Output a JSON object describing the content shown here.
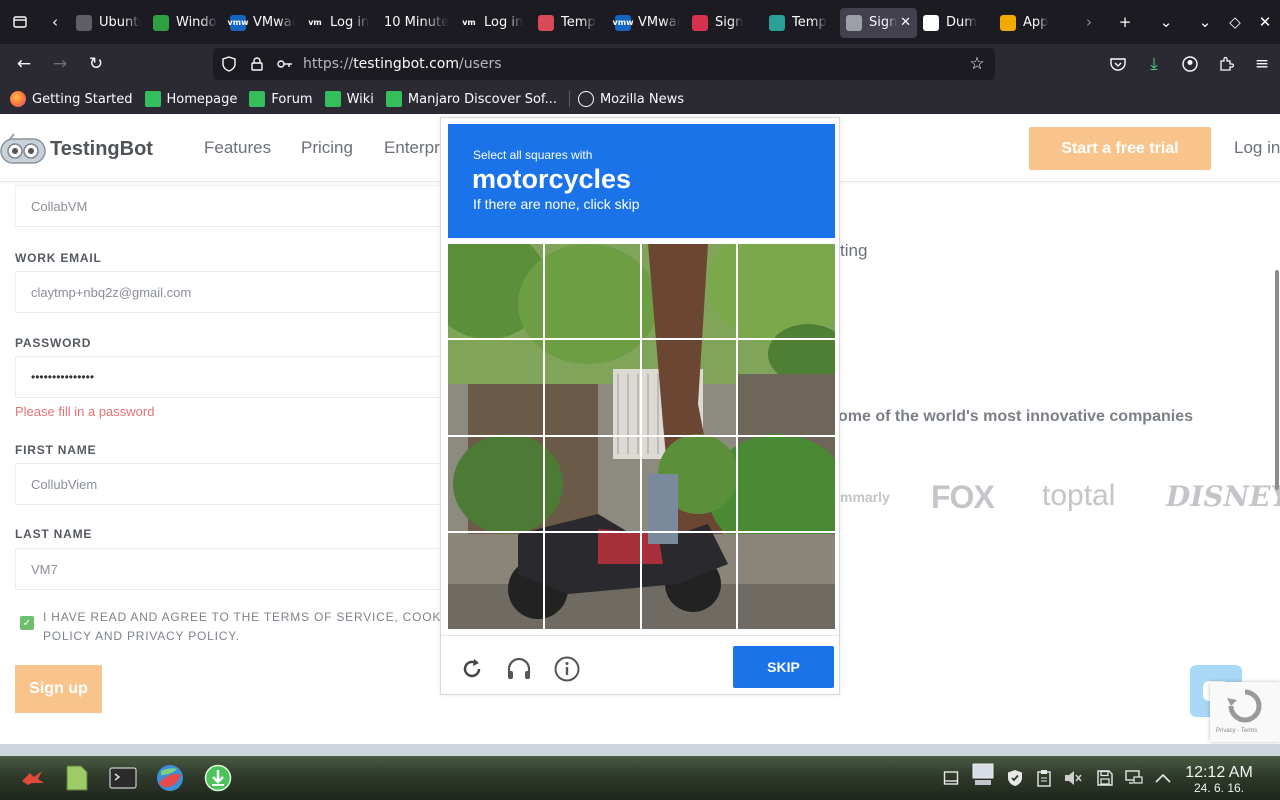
{
  "browser": {
    "tabs": [
      {
        "label": "Ubuntu",
        "fav_color": "#5e5e66",
        "fav_text": ""
      },
      {
        "label": "Windows",
        "fav_color": "#2ea043",
        "fav_text": ""
      },
      {
        "label": "VMware",
        "fav_color": "#1565c0",
        "fav_text": "vmw"
      },
      {
        "label": "Log in",
        "fav_color": "#1c1b22",
        "fav_text": "vm"
      },
      {
        "label": "10 Minute",
        "fav_color": "",
        "fav_text": ""
      },
      {
        "label": "Log in",
        "fav_color": "#1c1b22",
        "fav_text": "vm"
      },
      {
        "label": "Temp",
        "fav_color": "#d84a57",
        "fav_text": ""
      },
      {
        "label": "VMware",
        "fav_color": "#1565c0",
        "fav_text": "vmw"
      },
      {
        "label": "Sign",
        "fav_color": "#d6324e",
        "fav_text": ""
      },
      {
        "label": "Temp",
        "fav_color": "#2aa198",
        "fav_text": ""
      },
      {
        "label": "Sign",
        "fav_color": "#9aa0a6",
        "fav_text": ""
      },
      {
        "label": "Dum",
        "fav_color": "#ffffff",
        "fav_text": ""
      },
      {
        "label": "App",
        "fav_color": "#f2a900",
        "fav_text": ""
      }
    ],
    "active_tab_index": 10,
    "url": {
      "scheme": "https://",
      "host": "testingbot.com",
      "path": "/users"
    },
    "bookmarks": [
      "Getting Started",
      "Homepage",
      "Forum",
      "Wiki",
      "Manjaro Discover Sof...",
      "Mozilla News"
    ]
  },
  "site": {
    "logo_text": "TestingBot",
    "nav": [
      "Features",
      "Pricing",
      "Enterpr"
    ],
    "trial_button": "Start a free trial",
    "login": "Log in",
    "form": {
      "company_value": "CollabVM",
      "email_label": "WORK EMAIL",
      "email_value": "claytmp+nbq2z@gmail.com",
      "password_label": "PASSWORD",
      "password_value": "•••••••••••••••",
      "password_error": "Please fill in a password",
      "first_name_label": "FIRST NAME",
      "first_name_value": "CollubViem",
      "last_name_label": "LAST NAME",
      "last_name_value": "VM7",
      "terms_text": "I HAVE READ AND AGREE TO THE TERMS OF SERVICE, COOKIE POLICY AND PRIVACY POLICY.",
      "signup_button": "Sign up"
    },
    "right": {
      "line1": "ting",
      "trusted_text": "ome of the world's most innovative companies",
      "brands": [
        "mmarly",
        "FOX",
        "toptal",
        "DISNEY"
      ]
    },
    "recaptcha_text": "Privacy - Terms"
  },
  "captcha": {
    "small": "Select all squares with",
    "target": "motorcycles",
    "sub": "If there are none, click skip",
    "skip_button": "SKIP",
    "header_color": "#1a73e8"
  },
  "taskbar": {
    "time": "12:12 AM",
    "date": "24. 6. 16."
  }
}
